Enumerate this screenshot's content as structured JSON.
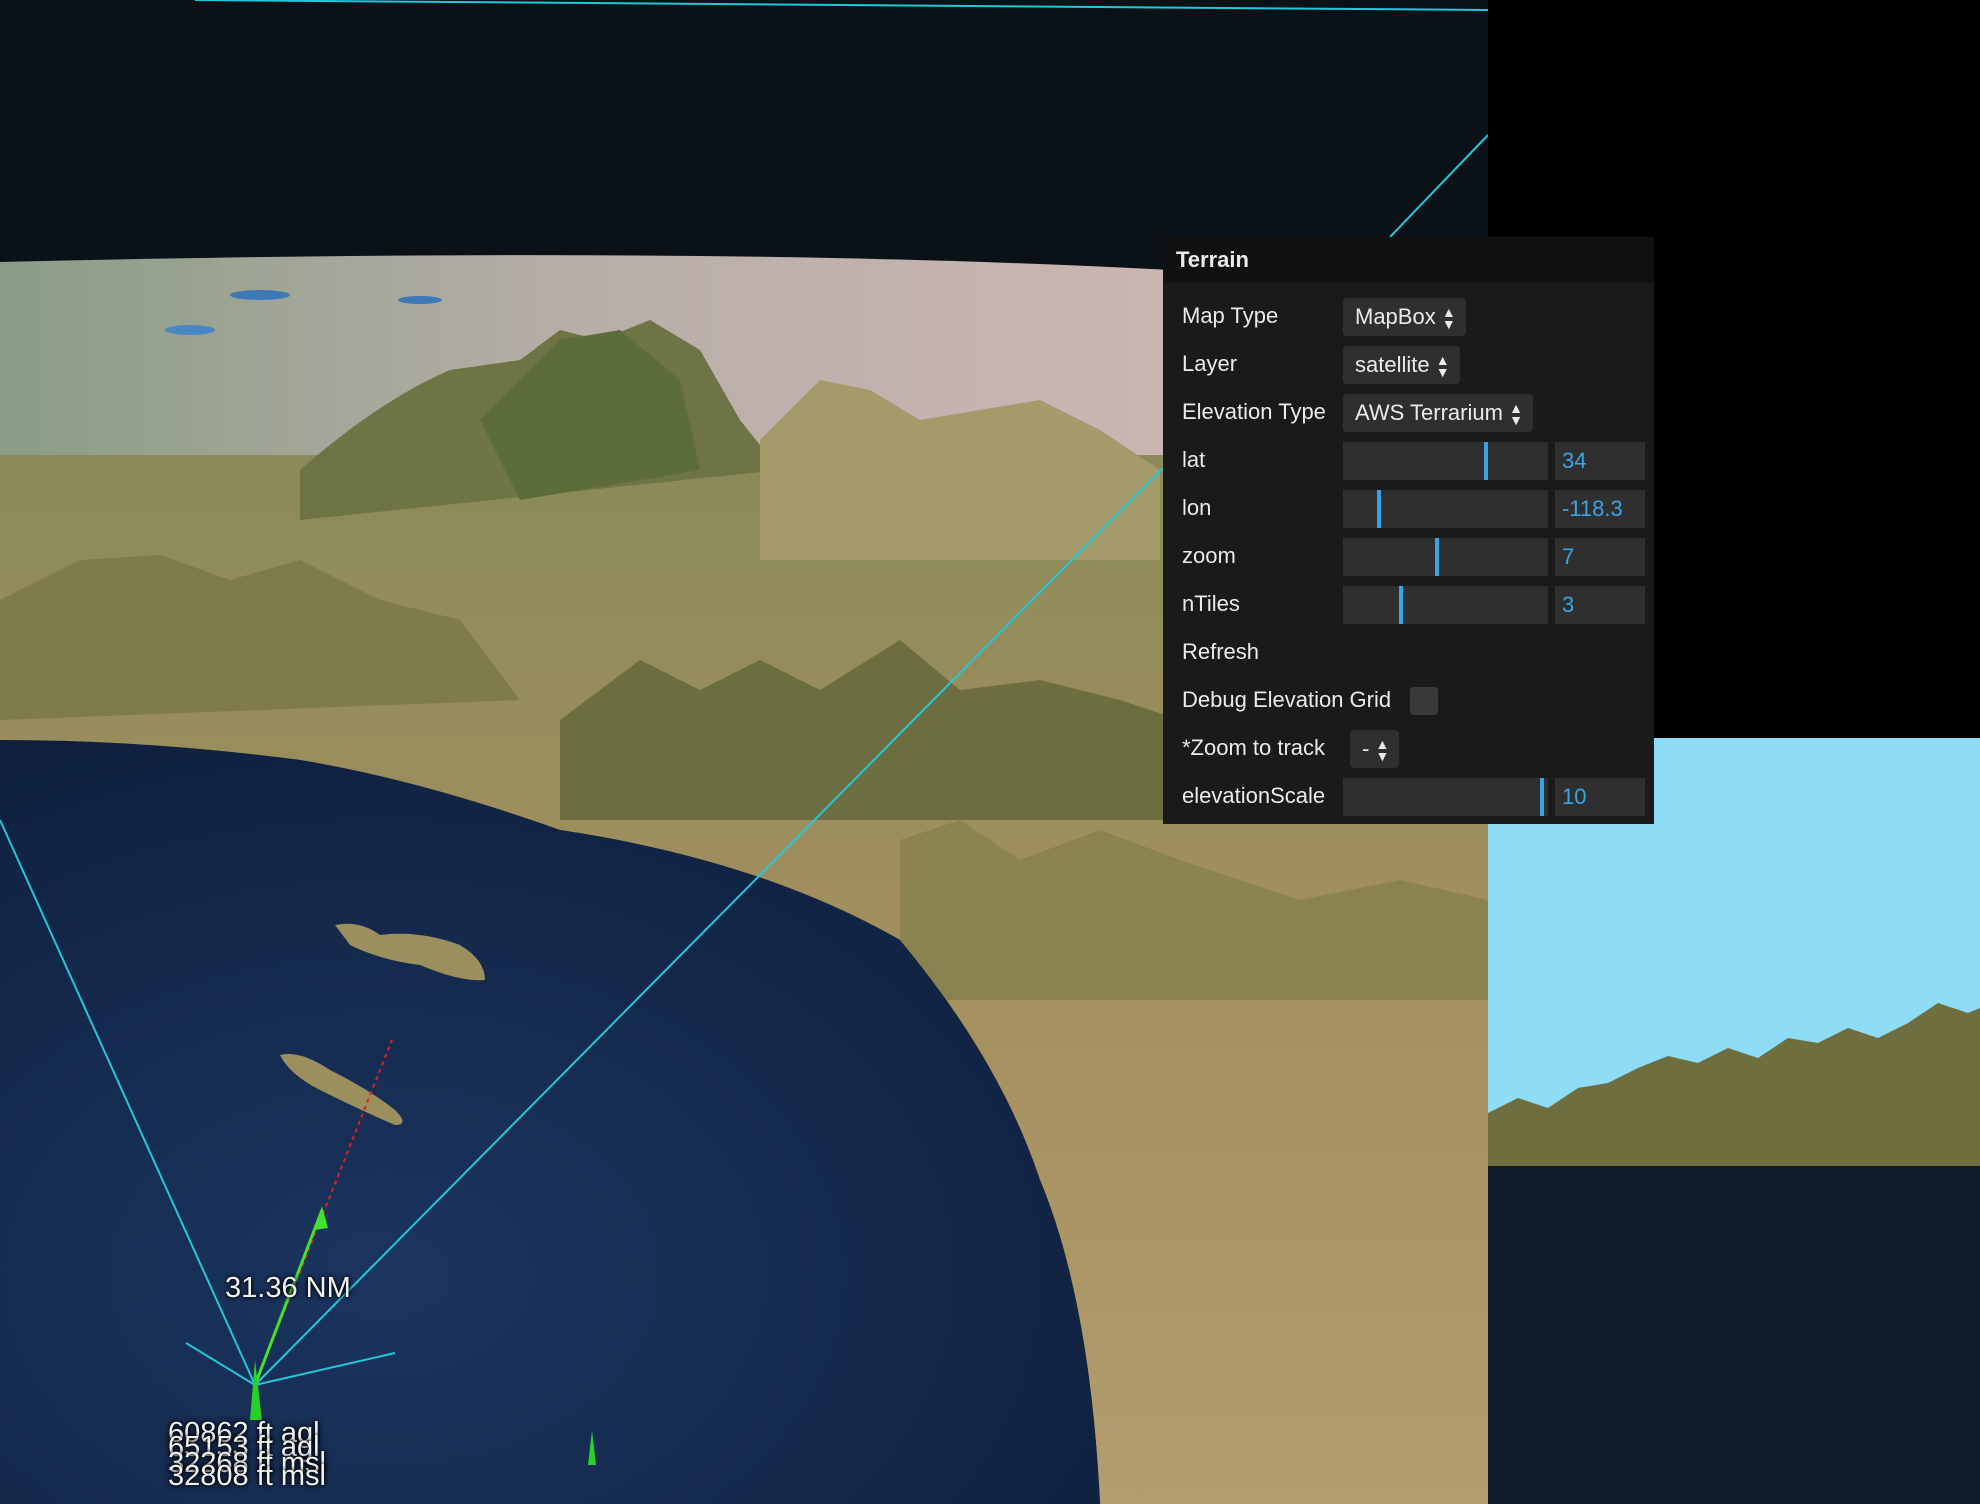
{
  "viewport": {
    "distance_label": "31.36 NM",
    "altitude_labels": [
      "60862 ft agl",
      "65153 ft agl",
      "32268 ft msl",
      "32808 ft msl"
    ]
  },
  "terrain_panel": {
    "title": "Terrain",
    "map_type": {
      "label": "Map Type",
      "value": "MapBox"
    },
    "layer": {
      "label": "Layer",
      "value": "satellite"
    },
    "elevation_type": {
      "label": "Elevation Type",
      "value": "AWS Terrarium"
    },
    "lat": {
      "label": "lat",
      "value": "34",
      "fraction": 0.7
    },
    "lon": {
      "label": "lon",
      "value": "-118.3",
      "fraction": 0.17
    },
    "zoom": {
      "label": "zoom",
      "value": "7",
      "fraction": 0.46
    },
    "ntiles": {
      "label": "nTiles",
      "value": "3",
      "fraction": 0.28
    },
    "refresh_label": "Refresh",
    "debug_elevation_grid": {
      "label": "Debug Elevation Grid",
      "checked": false
    },
    "zoom_to_track": {
      "label": "*Zoom to track",
      "value": "-"
    },
    "elevation_scale": {
      "label": "elevationScale",
      "value": "10",
      "fraction": 0.98
    }
  },
  "colors": {
    "accent": "#38a6e6",
    "track_line": "#23c8d8",
    "side_sky": "#8fdcf7",
    "ocean": "#14284a"
  },
  "icons": {
    "select_arrows": "updown-chevron-icon"
  }
}
